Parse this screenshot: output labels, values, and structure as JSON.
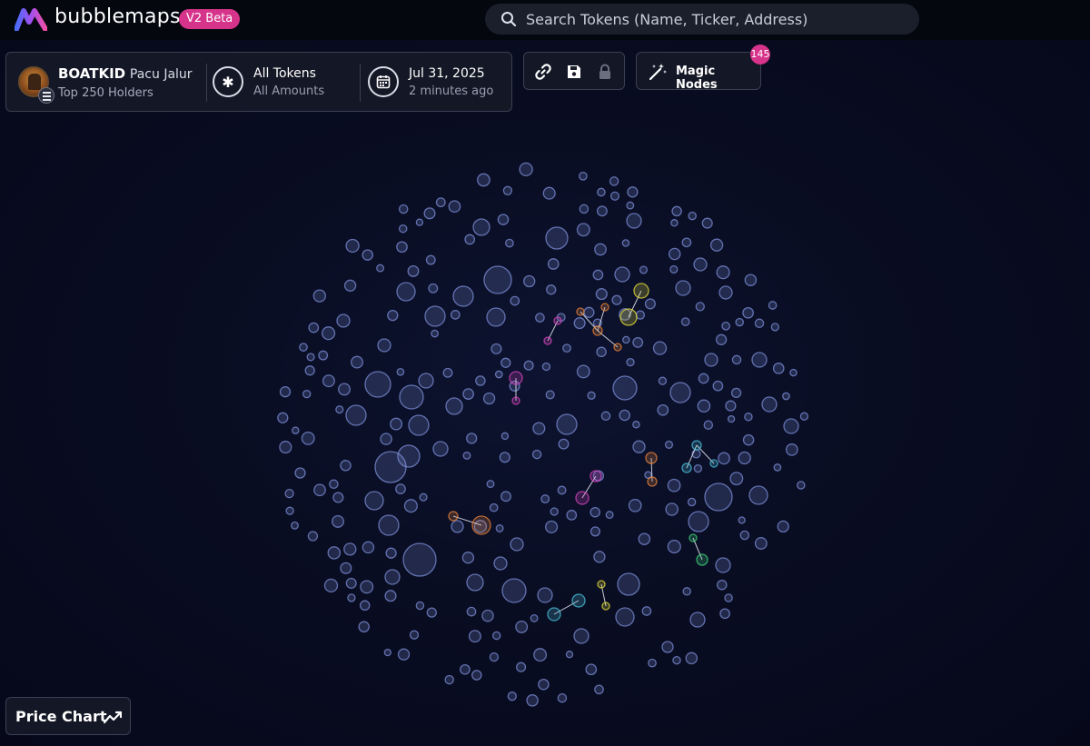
{
  "header": {
    "brand": "bubblemaps",
    "version_badge": "V2 Beta",
    "search_placeholder": "Search Tokens (Name, Ticker, Address)"
  },
  "token": {
    "ticker": "BOATKID",
    "name": "Pacu Jalur",
    "holders": "Top 250 Holders"
  },
  "filter": {
    "tokens": "All Tokens",
    "amounts": "All Amounts"
  },
  "snapshot": {
    "date": "Jul 31, 2025",
    "relative": "2 minutes ago"
  },
  "toolbar": {
    "magic_nodes_label": "Magic Nodes",
    "magic_nodes_count": "145"
  },
  "footer": {
    "price_chart_label": "Price Chart"
  },
  "colors": {
    "accent_pink": "#d6338a",
    "bubble_default": "#7d8fd8",
    "cluster_pink": "#d946c0",
    "cluster_orange": "#f0873a",
    "cluster_yellow": "#e8e03a",
    "cluster_cyan": "#4cc6e0",
    "cluster_green": "#3fd679"
  }
}
